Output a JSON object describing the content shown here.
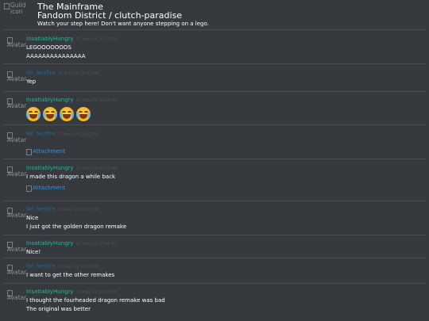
{
  "header": {
    "guild_icon_alt": "Guild icon",
    "title": "The Mainframe",
    "channel": "Fandom District / clutch-paradise",
    "topic": "Watch your step here! Don't want anyone stepping on a lego."
  },
  "avatar_alt": "Avatar",
  "attachment_label": "Attachment",
  "colors": {
    "background": "#36393e",
    "author_insatiably": "#1abc9c",
    "author_mr": "#206694",
    "link": "#2f95dc"
  },
  "messages": [
    {
      "author": "InsatiablyHungry",
      "time": "07-May-19 10:07 PM",
      "lines": [
        "LEGOOOOOOOS",
        "AAAAAAAAAAAAAAA"
      ]
    },
    {
      "author": "Mr. Nerfire",
      "time": "07-May-19 10:07 PM",
      "lines": [
        "Yep"
      ]
    },
    {
      "author": "InsatiablyHungry",
      "time": "07-May-19 10:07 PM",
      "emoji": [
        "joy-icon",
        "joy-icon",
        "joy-icon",
        "joy-icon"
      ]
    },
    {
      "author": "Mr. Nerfire",
      "time": "07-May-19 10:07 PM"
    },
    {
      "author": "InsatiablyHungry",
      "time": "07-May-19 10:07 PM",
      "lines": [
        "I made this dragon a while back"
      ]
    },
    {
      "author": "Mr. Nerfire",
      "time": "07-May-19 10:07 PM",
      "lines": [
        "Nice",
        "I just got the golden dragon remake"
      ]
    },
    {
      "author": "InsatiablyHungry",
      "time": "07-May-19 10:08 PM",
      "lines": [
        "Nice!"
      ]
    },
    {
      "author": "Mr. Nerfire",
      "time": "07-May-19 10:08 PM",
      "lines": [
        "I want to get the other remakes"
      ]
    },
    {
      "author": "InsatiablyHungry",
      "time": "07-May-19 10:09 PM",
      "lines": [
        "I thought the fourheaded dragon remake was bad",
        "The original was better"
      ]
    }
  ]
}
